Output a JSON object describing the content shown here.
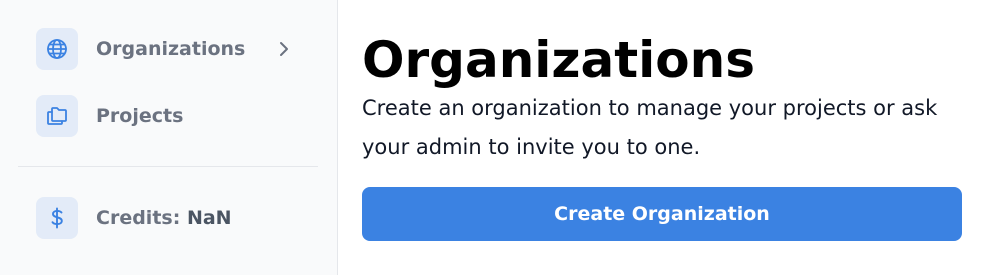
{
  "sidebar": {
    "items": [
      {
        "label": "Organizations",
        "icon": "globe-icon",
        "has_chevron": true
      },
      {
        "label": "Projects",
        "icon": "folders-icon"
      }
    ],
    "credits": {
      "label": "Credits:",
      "value": "NaN",
      "icon": "dollar-icon"
    }
  },
  "main": {
    "title": "Organizations",
    "description": "Create an organization to manage your projects or ask your admin to invite you to one.",
    "create_button_label": "Create Organization"
  },
  "colors": {
    "accent": "#3b82e2",
    "icon_bg": "#e3ebf8",
    "icon_stroke": "#3b82e2",
    "sidebar_bg": "#f9fafb"
  }
}
